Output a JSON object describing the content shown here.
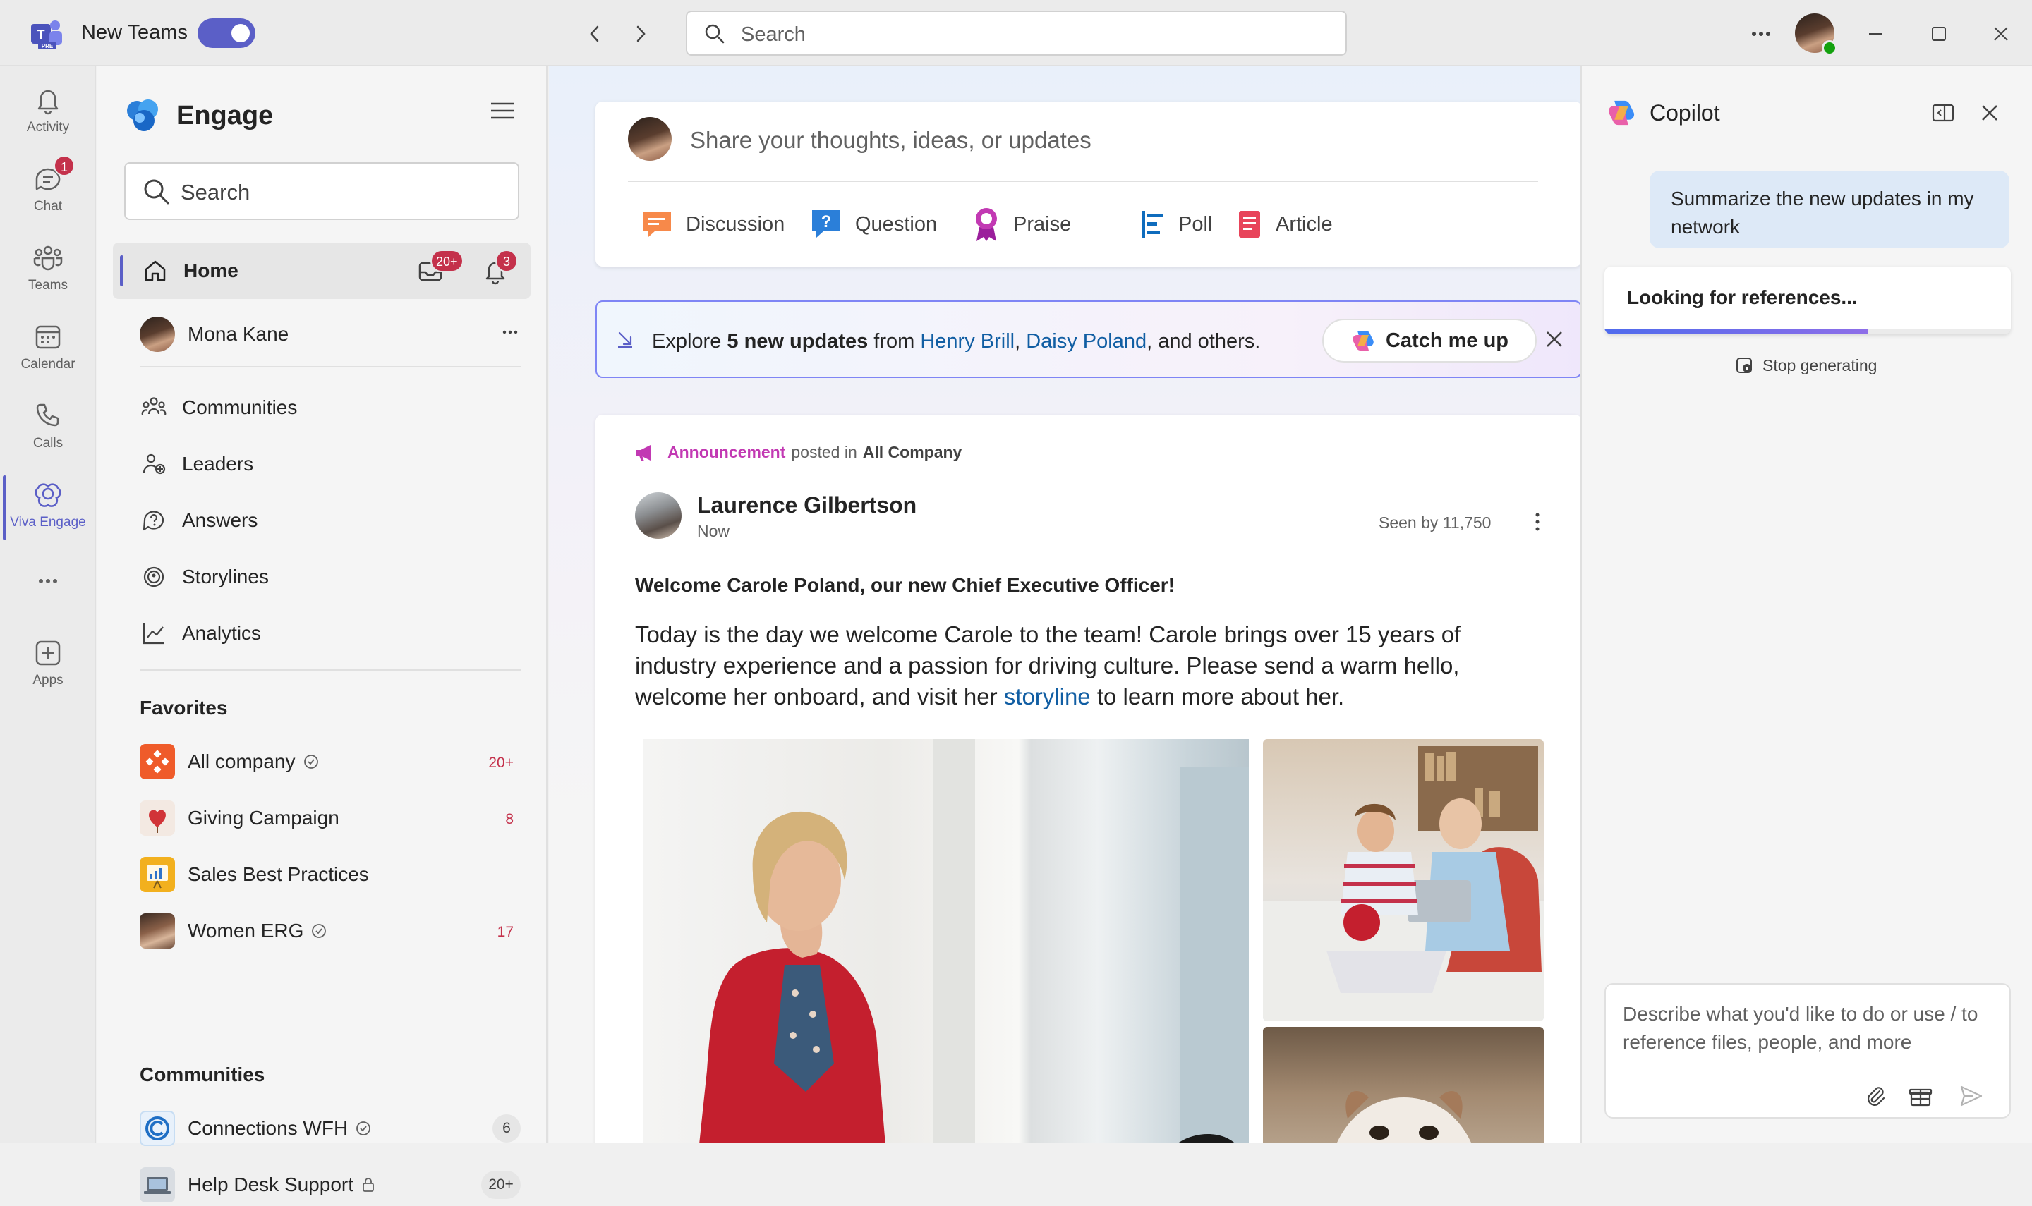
{
  "titlebar": {
    "app_name": "New Teams",
    "search_placeholder": "Search"
  },
  "rail": {
    "items": [
      {
        "label": "Activity"
      },
      {
        "label": "Chat",
        "badge": "1"
      },
      {
        "label": "Teams"
      },
      {
        "label": "Calendar"
      },
      {
        "label": "Calls"
      },
      {
        "label": "Viva Engage",
        "active": true
      },
      {
        "label": "Apps"
      }
    ]
  },
  "engage": {
    "title": "Engage",
    "search_placeholder": "Search",
    "home": {
      "label": "Home",
      "inbox_badge": "20+",
      "notif_badge": "3"
    },
    "user": {
      "name": "Mona Kane"
    },
    "nav": [
      {
        "label": "Communities"
      },
      {
        "label": "Leaders"
      },
      {
        "label": "Answers"
      },
      {
        "label": "Storylines"
      },
      {
        "label": "Analytics"
      }
    ],
    "favorites_heading": "Favorites",
    "favorites": [
      {
        "name": "All company",
        "count": "20+"
      },
      {
        "name": "Giving Campaign",
        "count": "8"
      },
      {
        "name": "Sales Best Practices",
        "count": ""
      },
      {
        "name": "Women ERG",
        "count": "17"
      }
    ],
    "communities_heading": "Communities",
    "communities": [
      {
        "name": "Connections WFH",
        "count": "6"
      },
      {
        "name": "Help Desk Support",
        "count": "20+"
      }
    ]
  },
  "composer": {
    "placeholder": "Share your thoughts, ideas, or updates",
    "types": [
      "Discussion",
      "Question",
      "Praise",
      "Poll",
      "Article"
    ]
  },
  "catchup": {
    "pre": "Explore ",
    "count": "5 new updates",
    "mid": " from ",
    "person1": "Henry Brill",
    "comma": ", ",
    "person2": "Daisy Poland",
    "post": ", and others.",
    "button": "Catch me up"
  },
  "post": {
    "type": "Announcement",
    "posted_in": "posted in",
    "group": "All Company",
    "author": "Laurence Gilbertson",
    "time": "Now",
    "seen": "Seen by 11,750",
    "headline": "Welcome Carole Poland, our new Chief Executive Officer!",
    "body_pre": "Today is the day we welcome Carole to the team! Carole brings over 15 years of industry experience and a passion for driving culture. Please send a warm hello, welcome her onboard, and visit her ",
    "body_link": "storyline",
    "body_post": " to learn more about her."
  },
  "copilot": {
    "title": "Copilot",
    "user_message": "Summarize the new updates in my network",
    "status": "Looking for references...",
    "progress": 0.65,
    "stop_label": "Stop generating",
    "input_placeholder": "Describe what you'd like to do or use / to reference files, people, and more"
  },
  "colors": {
    "accent": "#5b5fc7",
    "badge_red": "#c4314b",
    "link_blue": "#115ea3",
    "announcement": "#c239b3"
  }
}
